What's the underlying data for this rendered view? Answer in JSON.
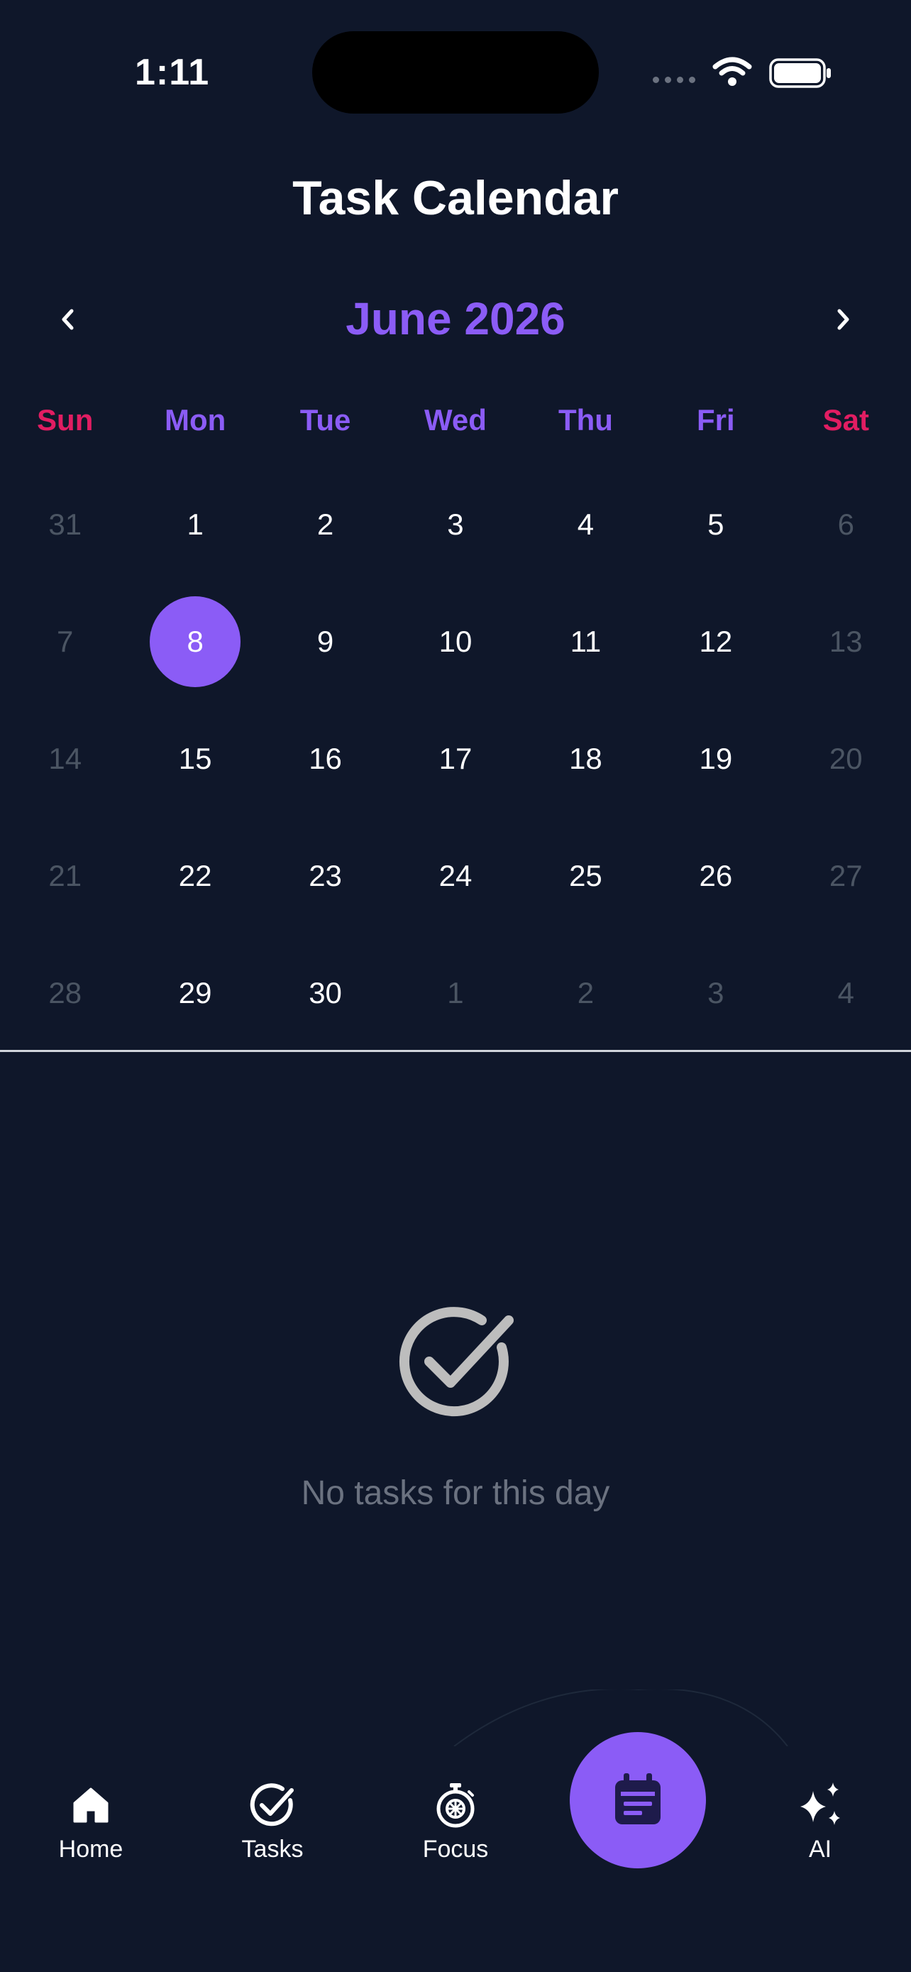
{
  "status_bar": {
    "time": "1:11"
  },
  "header": {
    "title": "Task Calendar",
    "month": "June 2026"
  },
  "weekdays": [
    "Sun",
    "Mon",
    "Tue",
    "Wed",
    "Thu",
    "Fri",
    "Sat"
  ],
  "days": [
    {
      "label": "31",
      "muted": true
    },
    {
      "label": "1"
    },
    {
      "label": "2"
    },
    {
      "label": "3"
    },
    {
      "label": "4"
    },
    {
      "label": "5"
    },
    {
      "label": "6",
      "muted": true
    },
    {
      "label": "7",
      "muted": true
    },
    {
      "label": "8",
      "selected": true
    },
    {
      "label": "9"
    },
    {
      "label": "10"
    },
    {
      "label": "11"
    },
    {
      "label": "12"
    },
    {
      "label": "13",
      "muted": true
    },
    {
      "label": "14",
      "muted": true
    },
    {
      "label": "15"
    },
    {
      "label": "16"
    },
    {
      "label": "17"
    },
    {
      "label": "18"
    },
    {
      "label": "19"
    },
    {
      "label": "20",
      "muted": true
    },
    {
      "label": "21",
      "muted": true
    },
    {
      "label": "22"
    },
    {
      "label": "23"
    },
    {
      "label": "24"
    },
    {
      "label": "25"
    },
    {
      "label": "26"
    },
    {
      "label": "27",
      "muted": true
    },
    {
      "label": "28",
      "muted": true
    },
    {
      "label": "29"
    },
    {
      "label": "30"
    },
    {
      "label": "1",
      "muted": true
    },
    {
      "label": "2",
      "muted": true
    },
    {
      "label": "3",
      "muted": true
    },
    {
      "label": "4",
      "muted": true
    }
  ],
  "empty_state": {
    "message": "No tasks for this day",
    "icon": "check-circle-icon"
  },
  "tabbar": {
    "home": "Home",
    "tasks": "Tasks",
    "focus": "Focus",
    "calendar_icon": "calendar-icon",
    "ai": "AI"
  },
  "colors": {
    "background": "#0f172a",
    "accent": "#8b5cf6",
    "weekend": "#e11d62",
    "muted": "#4b5563"
  }
}
